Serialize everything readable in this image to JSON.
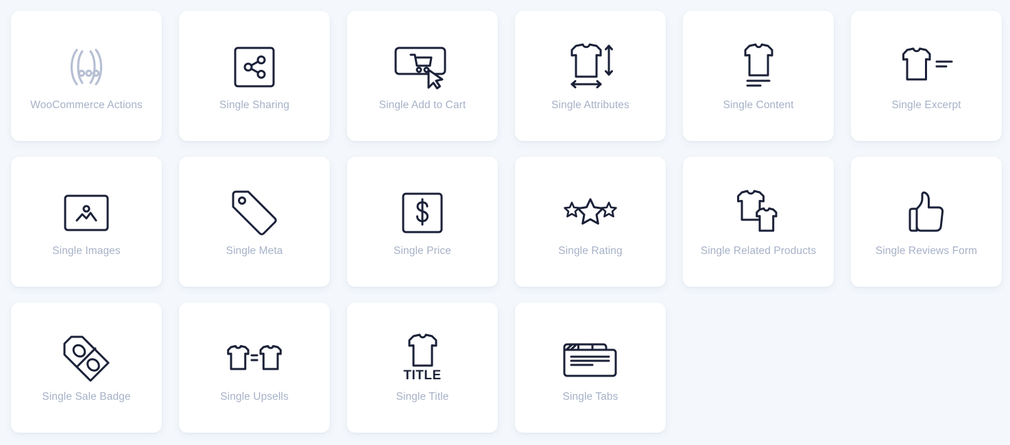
{
  "theme": {
    "page_background": "#f4f8fc",
    "card_background": "#ffffff",
    "icon_color": "#1b2138",
    "label_color": "#a6b1c7",
    "woocommerce_actions_icon_color": "#b6bfd3"
  },
  "grid": {
    "columns": 6,
    "rows": 3,
    "card_count": 16,
    "items": [
      {
        "label": "WooCommerce Actions",
        "icon": "woocommerce-actions-icon"
      },
      {
        "label": "Single Sharing",
        "icon": "share-icon"
      },
      {
        "label": "Single Add to Cart",
        "icon": "add-to-cart-icon"
      },
      {
        "label": "Single Attributes",
        "icon": "tshirt-dimensions-icon"
      },
      {
        "label": "Single Content",
        "icon": "tshirt-lines-icon"
      },
      {
        "label": "Single Excerpt",
        "icon": "tshirt-excerpt-icon"
      },
      {
        "label": "Single Images",
        "icon": "image-icon"
      },
      {
        "label": "Single Meta",
        "icon": "tag-icon"
      },
      {
        "label": "Single Price",
        "icon": "price-dollar-icon"
      },
      {
        "label": "Single Rating",
        "icon": "stars-rating-icon"
      },
      {
        "label": "Single Related Products",
        "icon": "two-tshirts-icon"
      },
      {
        "label": "Single Reviews Form",
        "icon": "thumbs-up-icon"
      },
      {
        "label": "Single Sale Badge",
        "icon": "percent-tag-icon"
      },
      {
        "label": "Single Upsells",
        "icon": "tshirt-equals-tshirt-icon"
      },
      {
        "label": "Single Title",
        "icon": "tshirt-title-icon"
      },
      {
        "label": "Single Tabs",
        "icon": "tabs-icon"
      }
    ],
    "title_icon_text": "TITLE"
  }
}
